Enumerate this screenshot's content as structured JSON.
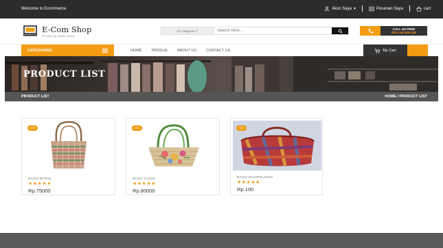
{
  "topbar": {
    "welcome": "Welcome to Ecommerce",
    "account": "Akun Saya",
    "orders": "Pesanan Saya",
    "cart": "cart"
  },
  "header": {
    "brand": "E-Com Shop",
    "tagline": "Shopping Made Easy",
    "search_category": "All Categories",
    "search_placeholder": "Search here...",
    "call_line1": "CALL US FREE",
    "call_line2": "0811 442 865 438"
  },
  "nav": {
    "categories_label": "CATEGORIES",
    "menu": [
      "HOME",
      "PRODUK",
      "ABOUT US",
      "CONTACT US"
    ],
    "cart_label": "My Cart"
  },
  "banner": {
    "title": "PRODUCT LIST"
  },
  "breadcrumb": {
    "page": "PRODUCT LIST",
    "path": "HOME / PRODUCT LIST"
  },
  "products": [
    {
      "badge": "NEW",
      "name": "RAJUT ROTAN",
      "stars": "★★★★★",
      "price": "Rp.75000"
    },
    {
      "badge": "NEW",
      "name": "RAJUT CLOUT",
      "stars": "★★★★★",
      "price": "Rp.80000"
    },
    {
      "badge": "NEW",
      "name": "RAJUT RAJAPOLAHAN",
      "stars": "★★★★★",
      "price": "Rp.100"
    }
  ],
  "colors": {
    "accent": "#f39c12",
    "dark": "#2c2c2c",
    "footer": "#5a5a5a"
  }
}
